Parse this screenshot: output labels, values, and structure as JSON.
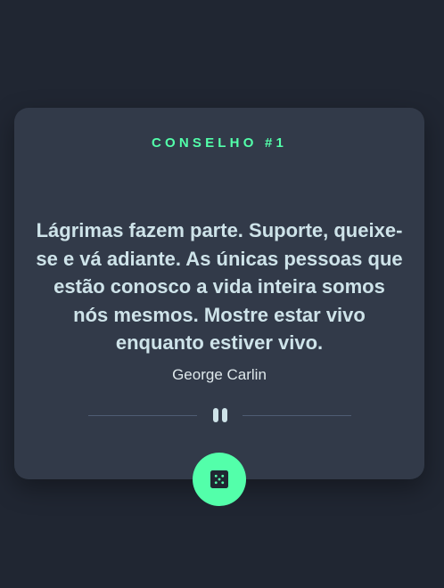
{
  "card": {
    "title": "CONSELHO #1",
    "quote": "Lágrimas fazem parte. Suporte, queixe-se e vá adiante. As únicas pessoas que estão conosco a vida inteira somos nós mesmos. Mostre estar vivo enquanto estiver vivo.",
    "author": "George Carlin",
    "divider_icon": "pause-icon"
  },
  "button": {
    "icon": "dice-icon"
  },
  "colors": {
    "background": "#202632",
    "card": "#323a49",
    "accent": "#53ffaa",
    "text": "#cee3e9",
    "divider": "#4f5d74"
  }
}
